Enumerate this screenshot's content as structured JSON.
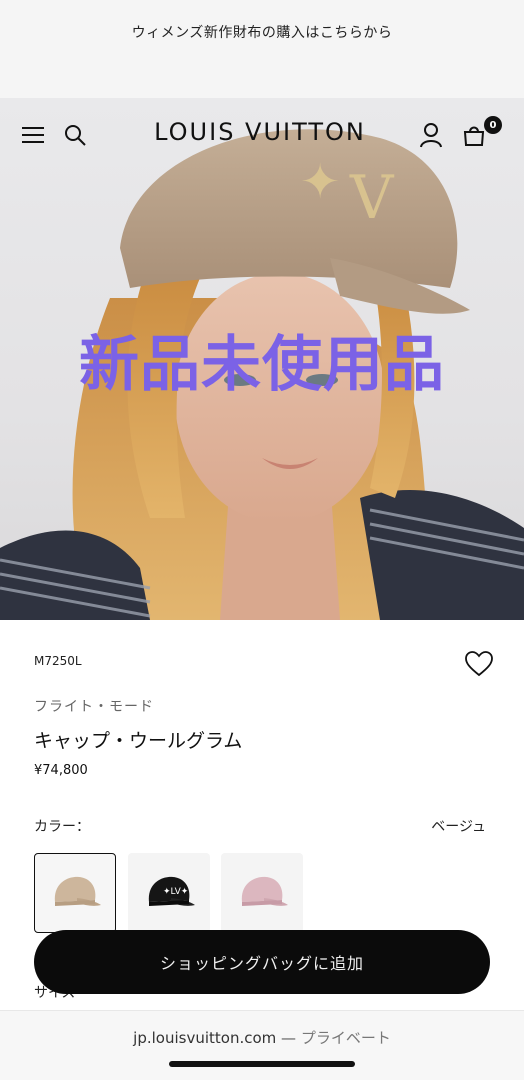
{
  "promo": {
    "text": "ウィメンズ新作財布の購入はこちらから"
  },
  "header": {
    "brand": "LOUIS VUITTON",
    "bag_count": "0"
  },
  "overlay": {
    "text": "新品未使用品"
  },
  "product": {
    "sku": "M7250L",
    "collection": "フライト・モード",
    "name": "キャップ・ウールグラム",
    "price": "¥74,800"
  },
  "color": {
    "label": "カラー：",
    "value": "ベージュ",
    "swatches": [
      "beige",
      "black",
      "pink"
    ]
  },
  "size": {
    "label": "サイズ"
  },
  "cta": {
    "label": "ショッピングバッグに追加"
  },
  "browser": {
    "domain": "jp.louisvuitton.com",
    "separator": "—",
    "mode": "プライベート"
  },
  "icons": [
    "menu-icon",
    "search-icon",
    "account-icon",
    "bag-icon",
    "heart-icon"
  ],
  "colors": {
    "overlay": "#7b62e6",
    "button": "#0b0b0b",
    "promo_bg": "#f5f5f5"
  }
}
